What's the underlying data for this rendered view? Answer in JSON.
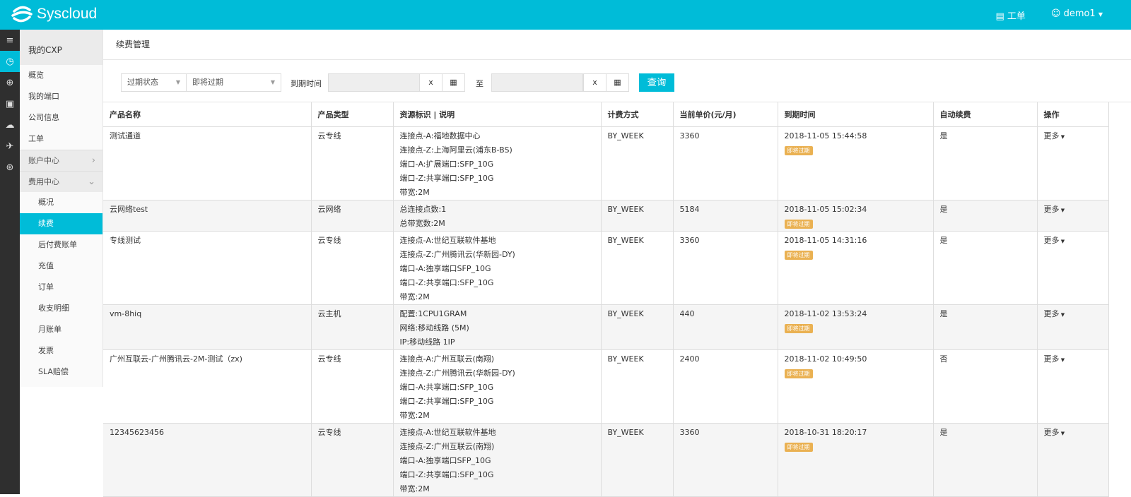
{
  "header": {
    "brand": "Syscloud",
    "ticket": "工单",
    "user": "demo1"
  },
  "iconbar": [
    "menu-icon",
    "dashboard-icon",
    "globe-icon",
    "port-icon",
    "cloud-icon",
    "rocket-icon",
    "network-icon"
  ],
  "sidebar": {
    "title": "我的CXP",
    "items": [
      "概览",
      "我的端口",
      "公司信息",
      "工单"
    ],
    "groups": [
      {
        "label": "账户中心",
        "chev": "›"
      },
      {
        "label": "费用中心",
        "chev": "⌄"
      }
    ],
    "sub": [
      "概况",
      "续费",
      "后付费账单",
      "充值",
      "订单",
      "收支明细",
      "月账单",
      "发票",
      "SLA赔偿"
    ]
  },
  "page": {
    "title": "续费管理"
  },
  "filter": {
    "status_label": "过期状态",
    "status_value": "即将过期",
    "expiry_label": "到期时间",
    "to": "至",
    "clear": "x",
    "query": "查询"
  },
  "table": {
    "headers": [
      "产品名称",
      "产品类型",
      "资源标识 | 说明",
      "计费方式",
      "当前单价(元/月)",
      "到期时间",
      "自动续费",
      "操作"
    ],
    "rows": [
      {
        "name": "测试通道",
        "type": "云专线",
        "desc": [
          "连接点-A:福地数据中心",
          "连接点-Z:上海阿里云(浦东B-BS)",
          "端口-A:扩展端口:SFP_10G",
          "端口-Z:共享端口:SFP_10G",
          "带宽:2M"
        ],
        "billing": "BY_WEEK",
        "price": "3360",
        "expiry": "2018-11-05 15:44:58",
        "badge": "即将过期",
        "auto": "是",
        "op": "更多"
      },
      {
        "name": "云网络test",
        "type": "云网络",
        "desc": [
          "总连接点数:1",
          "总带宽数:2M"
        ],
        "billing": "BY_WEEK",
        "price": "5184",
        "expiry": "2018-11-05 15:02:34",
        "badge": "即将过期",
        "auto": "是",
        "op": "更多"
      },
      {
        "name": "专线测试",
        "type": "云专线",
        "desc": [
          "连接点-A:世纪互联软件基地",
          "连接点-Z:广州腾讯云(华新园-DY)",
          "端口-A:独享端口SFP_10G",
          "端口-Z:共享端口:SFP_10G",
          "带宽:2M"
        ],
        "billing": "BY_WEEK",
        "price": "3360",
        "expiry": "2018-11-05 14:31:16",
        "badge": "即将过期",
        "auto": "是",
        "op": "更多"
      },
      {
        "name": "vm-8hiq",
        "type": "云主机",
        "desc": [
          "配置:1CPU1GRAM",
          "网络:移动线路 (5M)",
          "IP:移动线路 1IP"
        ],
        "billing": "BY_WEEK",
        "price": "440",
        "expiry": "2018-11-02 13:53:24",
        "badge": "即将过期",
        "auto": "是",
        "op": "更多"
      },
      {
        "name": "广州互联云-广州腾讯云-2M-测试（zx)",
        "type": "云专线",
        "desc": [
          "连接点-A:广州互联云(南翔)",
          "连接点-Z:广州腾讯云(华新园-DY)",
          "端口-A:共享端口:SFP_10G",
          "端口-Z:共享端口:SFP_10G",
          "带宽:2M"
        ],
        "billing": "BY_WEEK",
        "price": "2400",
        "expiry": "2018-11-02 10:49:50",
        "badge": "即将过期",
        "auto": "否",
        "op": "更多"
      },
      {
        "name": "12345623456",
        "type": "云专线",
        "desc": [
          "连接点-A:世纪互联软件基地",
          "连接点-Z:广州互联云(南翔)",
          "端口-A:独享端口SFP_10G",
          "端口-Z:共享端口:SFP_10G",
          "带宽:2M"
        ],
        "billing": "BY_WEEK",
        "price": "3360",
        "expiry": "2018-10-31 18:20:17",
        "badge": "即将过期",
        "auto": "是",
        "op": "更多"
      }
    ]
  },
  "colors": {
    "brand": "#00bcd8",
    "badge": "#eab152"
  }
}
